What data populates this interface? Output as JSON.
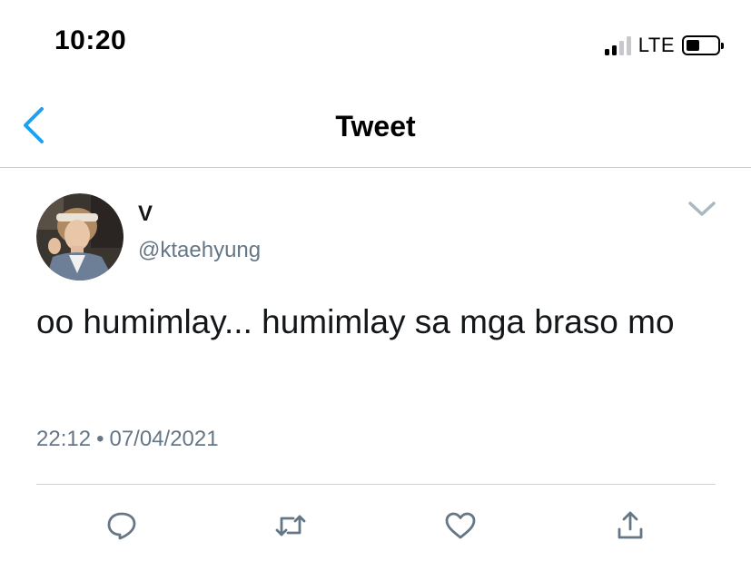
{
  "status_bar": {
    "time": "10:20",
    "carrier": "LTE"
  },
  "nav": {
    "title": "Tweet",
    "accent_color": "#1da1f2"
  },
  "tweet": {
    "display_name": "V",
    "handle": "@ktaehyung",
    "text": "oo humimlay... humimlay sa mga braso mo",
    "time": "22:12",
    "separator": "•",
    "date": "07/04/2021"
  },
  "actions": {
    "icons": [
      "reply-icon",
      "retweet-icon",
      "like-icon",
      "share-icon"
    ],
    "icon_color": "#657786"
  }
}
